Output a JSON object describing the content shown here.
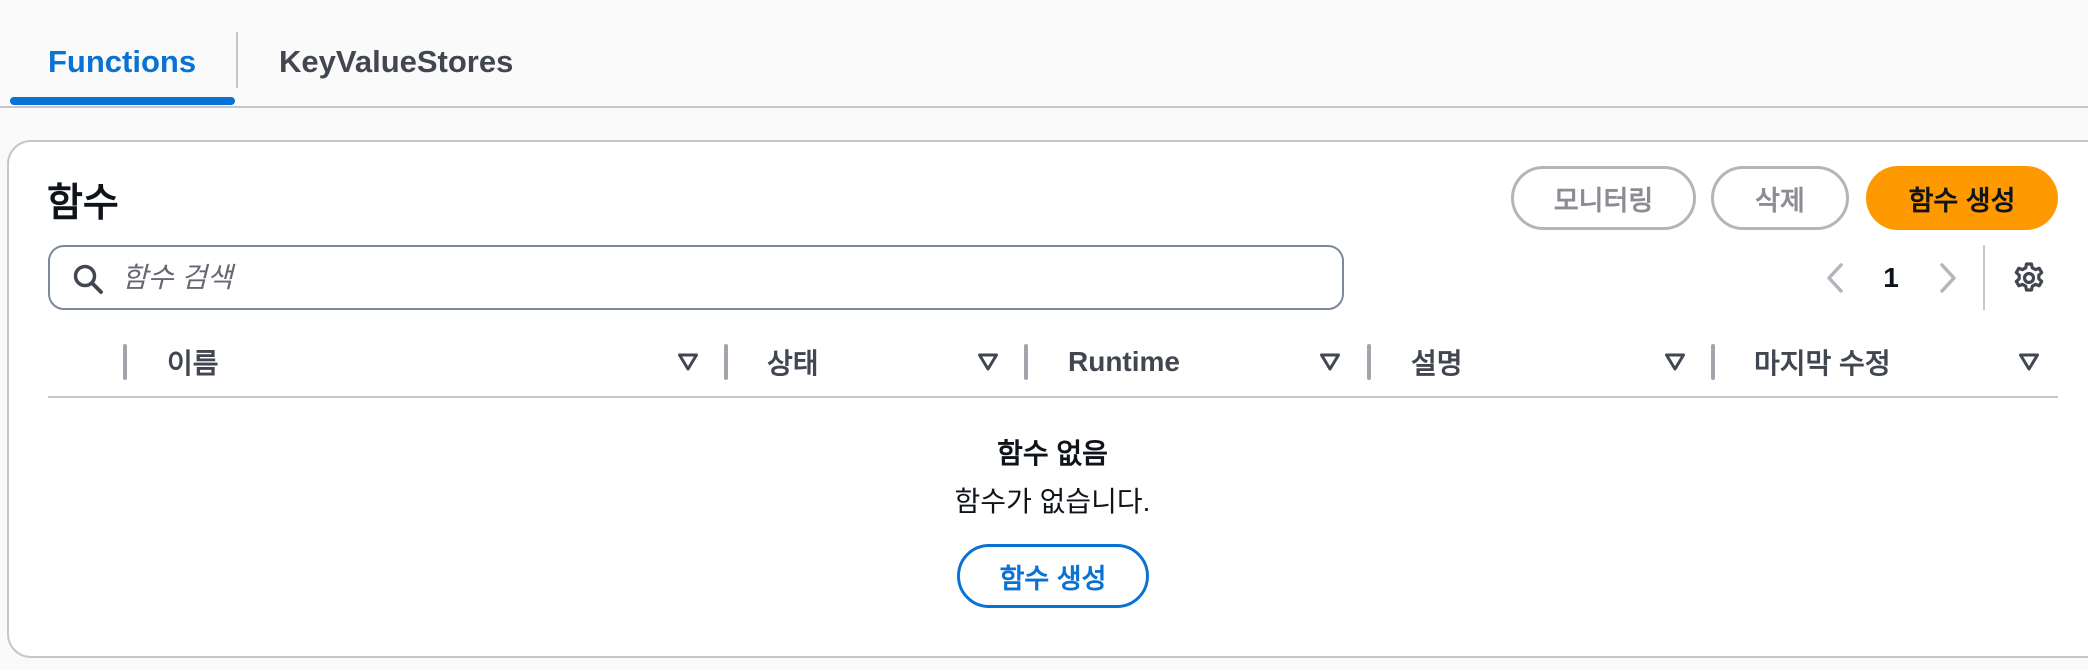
{
  "tabs": [
    {
      "label": "Functions",
      "active": true
    },
    {
      "label": "KeyValueStores",
      "active": false
    }
  ],
  "panel": {
    "title": "함수",
    "monitoring_label": "모니터링",
    "delete_label": "삭제",
    "create_label": "함수 생성"
  },
  "search": {
    "placeholder": "함수 검색",
    "icon": "search-icon"
  },
  "pagination": {
    "current_page": "1",
    "prev_icon": "chevron-left-icon",
    "next_icon": "chevron-right-icon",
    "settings_icon": "gear-icon"
  },
  "table": {
    "columns": [
      "이름",
      "상태",
      "Runtime",
      "설명",
      "마지막 수정"
    ],
    "rows": []
  },
  "empty": {
    "title": "함수 없음",
    "description": "함수가 없습니다.",
    "create_label": "함수 생성"
  },
  "colors": {
    "accent": "#0972d3",
    "primary_button": "#ff9900",
    "border": "#c6c6cd"
  }
}
